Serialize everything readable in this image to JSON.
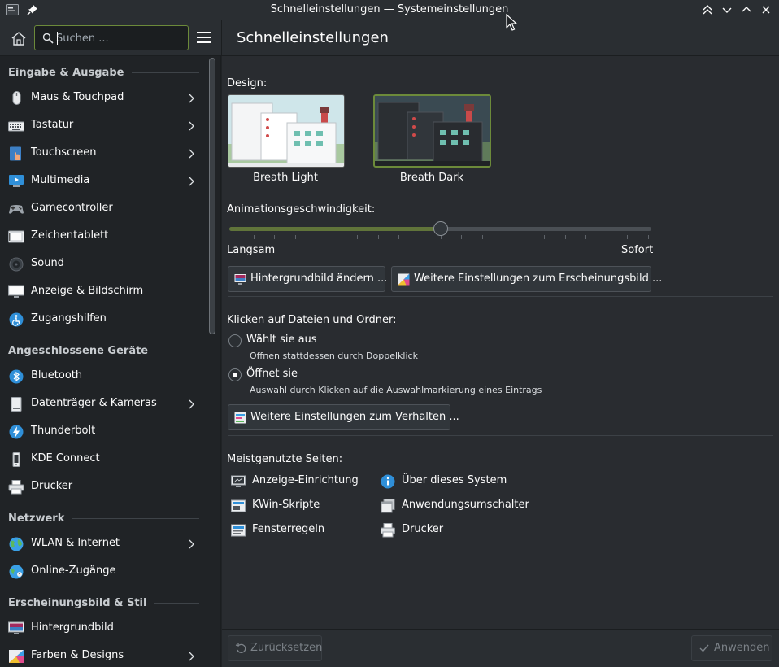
{
  "window": {
    "title": "Schnelleinstellungen — Systemeinstellungen"
  },
  "header": {
    "search_placeholder": "Suchen ...",
    "page_title": "Schnelleinstellungen"
  },
  "sidebar": {
    "sections": [
      {
        "title": "Eingabe & Ausgabe",
        "items": [
          {
            "label": "Maus & Touchpad",
            "icon": "mouse-icon",
            "has_children": true
          },
          {
            "label": "Tastatur",
            "icon": "keyboard-icon",
            "has_children": true
          },
          {
            "label": "Touchscreen",
            "icon": "touchscreen-icon",
            "has_children": true
          },
          {
            "label": "Multimedia",
            "icon": "multimedia-icon",
            "has_children": true
          },
          {
            "label": "Gamecontroller",
            "icon": "gamepad-icon",
            "has_children": false
          },
          {
            "label": "Zeichentablett",
            "icon": "tablet-icon",
            "has_children": false
          },
          {
            "label": "Sound",
            "icon": "speaker-icon",
            "has_children": false
          },
          {
            "label": "Anzeige & Bildschirm",
            "icon": "display-icon",
            "has_children": false
          },
          {
            "label": "Zugangshilfen",
            "icon": "accessibility-icon",
            "has_children": false
          }
        ]
      },
      {
        "title": "Angeschlossene Geräte",
        "items": [
          {
            "label": "Bluetooth",
            "icon": "bluetooth-icon",
            "has_children": false
          },
          {
            "label": "Datenträger & Kameras",
            "icon": "drive-icon",
            "has_children": true
          },
          {
            "label": "Thunderbolt",
            "icon": "thunderbolt-icon",
            "has_children": false
          },
          {
            "label": "KDE Connect",
            "icon": "phone-icon",
            "has_children": false
          },
          {
            "label": "Drucker",
            "icon": "printer-icon",
            "has_children": false
          }
        ]
      },
      {
        "title": "Netzwerk",
        "items": [
          {
            "label": "WLAN & Internet",
            "icon": "globe-icon",
            "has_children": true
          },
          {
            "label": "Online-Zugänge",
            "icon": "online-accounts-icon",
            "has_children": false
          }
        ]
      },
      {
        "title": "Erscheinungsbild & Stil",
        "items": [
          {
            "label": "Hintergrundbild",
            "icon": "wallpaper-icon",
            "has_children": false
          },
          {
            "label": "Farben & Designs",
            "icon": "colors-icon",
            "has_children": true
          }
        ]
      }
    ]
  },
  "main": {
    "design_label": "Design:",
    "themes": [
      {
        "name": "Breath Light",
        "selected": false
      },
      {
        "name": "Breath Dark",
        "selected": true
      }
    ],
    "animation_label": "Animationsgeschwindigkeit:",
    "animation_slider": {
      "value_fraction": 0.5,
      "min_label": "Langsam",
      "max_label": "Sofort"
    },
    "wallpaper_button": "Hintergrundbild ändern ...",
    "appearance_button": "Weitere Einstellungen zum Erscheinungsbild ...",
    "click_label": "Klicken auf Dateien und Ordner:",
    "click_options": [
      {
        "label": "Wählt sie aus",
        "description": "Öffnen stattdessen durch Doppelklick",
        "selected": false
      },
      {
        "label": "Öffnet sie",
        "description": "Auswahl durch Klicken auf die Auswahlmarkierung eines Eintrags",
        "selected": true
      }
    ],
    "behavior_button": "Weitere Einstellungen zum Verhalten ...",
    "most_used_label": "Meistgenutzte Seiten:",
    "most_used": [
      {
        "label": "Anzeige-Einrichtung",
        "icon": "display-config-icon"
      },
      {
        "label": "Über dieses System",
        "icon": "info-icon"
      },
      {
        "label": "KWin-Skripte",
        "icon": "kwin-scripts-icon"
      },
      {
        "label": "Anwendungsumschalter",
        "icon": "task-switcher-icon"
      },
      {
        "label": "Fensterregeln",
        "icon": "window-rules-icon"
      },
      {
        "label": "Drucker",
        "icon": "printer-icon"
      }
    ]
  },
  "footer": {
    "reset_label": "Zurücksetzen",
    "apply_label": "Anwenden"
  },
  "colors": {
    "accent": "#6c8a3a",
    "background": "#202326",
    "panel": "#292c30"
  }
}
